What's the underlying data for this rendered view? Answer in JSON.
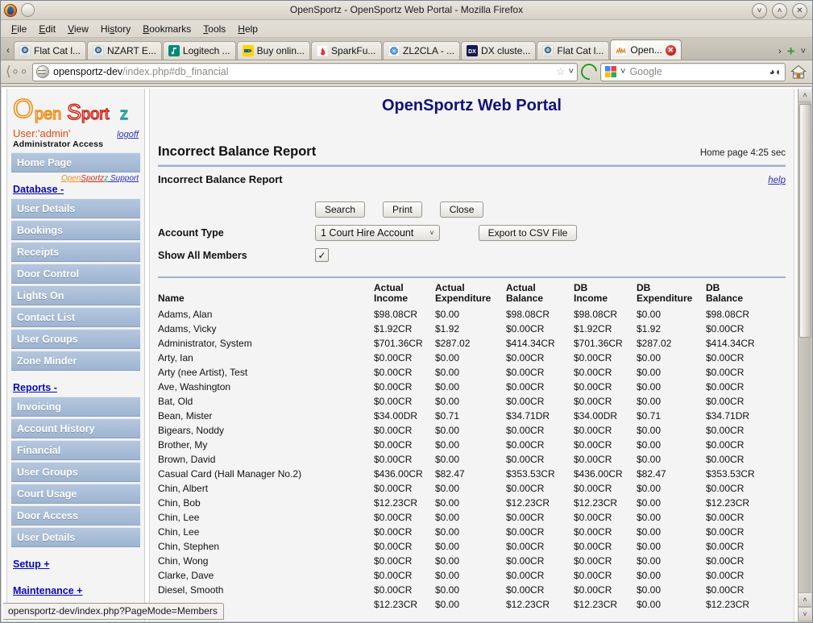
{
  "window": {
    "title": "OpenSportz - OpenSportz Web Portal - Mozilla Firefox",
    "minimize_label": "˅",
    "maximize_label": "˄",
    "close_label": "✕"
  },
  "menubar": [
    {
      "label": "File",
      "accel": "F"
    },
    {
      "label": "Edit",
      "accel": "E"
    },
    {
      "label": "View",
      "accel": "V"
    },
    {
      "label": "History",
      "accel": "s"
    },
    {
      "label": "Bookmarks",
      "accel": "B"
    },
    {
      "label": "Tools",
      "accel": "T"
    },
    {
      "label": "Help",
      "accel": "H"
    }
  ],
  "tabbar": {
    "scroll_left_icon": "‹",
    "scroll_right_icon": "›",
    "new_tab_icon": "+",
    "list_all_icon": "˅",
    "tabs": [
      {
        "label": "Flat Cat l...",
        "icon": "globe-photo-icon",
        "active": false
      },
      {
        "label": "NZART E...",
        "icon": "globe-photo-icon",
        "active": false
      },
      {
        "label": "Logitech ...",
        "icon": "music-note-icon",
        "active": false
      },
      {
        "label": "Buy onlin...",
        "icon": "trademe-icon",
        "active": false
      },
      {
        "label": "SparkFu...",
        "icon": "sparkfun-flame-icon",
        "active": false
      },
      {
        "label": "ZL2CLA - ...",
        "icon": "blue-grid-icon",
        "active": false
      },
      {
        "label": "DX cluste...",
        "icon": "dx-badge-icon",
        "active": false
      },
      {
        "label": "Flat Cat l...",
        "icon": "globe-photo-icon",
        "active": false
      },
      {
        "label": "Open...",
        "icon": "opensportz-icon",
        "active": true,
        "closable": true,
        "close_icon": "✕"
      }
    ]
  },
  "navbar": {
    "back_forward_icon": "back-forward-icon",
    "url_prefix": "opensportz-dev",
    "url_suffix": "/index.php#db_financial",
    "url_full": "opensportz-dev/index.php#db_financial",
    "bookmark_star_icon": "☆",
    "dropdown_icon": "˅",
    "reload_icon": "reload-icon",
    "search_engine": "google-icon",
    "search_placeholder": "Google",
    "search_submit_icon": "binoculars-icon",
    "home_icon": "home-icon"
  },
  "sidebar": {
    "logo": {
      "part_o": "O",
      "part_pen": "pen",
      "part_s": "S",
      "part_portz_port": "port",
      "part_z": "z",
      "color_orange": "#ef8f1c",
      "color_red": "#cf2a1d",
      "color_teal": "#1f9c9c"
    },
    "user_label": "User:'admin'",
    "logoff_label": "logoff",
    "access_label": "Administrator Access",
    "home_button": "Home Page",
    "support_link": {
      "open": "Open",
      "sportz": "Sportz",
      "z": "z",
      "support": " Support"
    },
    "database_header": "Database -",
    "database_items": [
      {
        "label": "User Details"
      },
      {
        "label": "Bookings"
      },
      {
        "label": "Receipts"
      },
      {
        "label": "Door Control"
      },
      {
        "label": "Lights On"
      },
      {
        "label": "Contact List"
      },
      {
        "label": "User Groups"
      },
      {
        "label": "Zone Minder"
      }
    ],
    "reports_header": "Reports -",
    "reports_items": [
      {
        "label": "Invoicing"
      },
      {
        "label": "Account History"
      },
      {
        "label": "Financial"
      },
      {
        "label": "User Groups"
      },
      {
        "label": "Court Usage"
      },
      {
        "label": "Door Access"
      },
      {
        "label": "User Details"
      }
    ],
    "setup_header": "Setup +",
    "maintenance_header": "Maintenance +"
  },
  "main": {
    "portal_title": "OpenSportz Web Portal",
    "report_title": "Incorrect Balance Report",
    "home_page_timer": "Home page 4:25 sec",
    "sub_title": "Incorrect Balance Report",
    "help_link": "help",
    "buttons": {
      "search": "Search",
      "print": "Print",
      "close": "Close",
      "export_csv": "Export to CSV File"
    },
    "account_type_label": "Account Type",
    "account_type_value": "1   Court Hire Account",
    "account_type_caret": "˅",
    "show_all_label": "Show All Members",
    "show_all_checked_icon": "✓"
  },
  "table": {
    "headers": [
      {
        "line1": "Name",
        "line2": ""
      },
      {
        "line1": "Actual",
        "line2": "Income"
      },
      {
        "line1": "Actual",
        "line2": "Expenditure"
      },
      {
        "line1": "Actual",
        "line2": "Balance"
      },
      {
        "line1": "DB",
        "line2": "Income"
      },
      {
        "line1": "DB",
        "line2": "Expenditure"
      },
      {
        "line1": "DB",
        "line2": "Balance"
      }
    ],
    "rows": [
      [
        "Adams, Alan",
        "$98.08CR",
        "$0.00",
        "$98.08CR",
        "$98.08CR",
        "$0.00",
        "$98.08CR"
      ],
      [
        "Adams, Vicky",
        "$1.92CR",
        "$1.92",
        "$0.00CR",
        "$1.92CR",
        "$1.92",
        "$0.00CR"
      ],
      [
        "Administrator, System",
        "$701.36CR",
        "$287.02",
        "$414.34CR",
        "$701.36CR",
        "$287.02",
        "$414.34CR"
      ],
      [
        "Arty, Ian",
        "$0.00CR",
        "$0.00",
        "$0.00CR",
        "$0.00CR",
        "$0.00",
        "$0.00CR"
      ],
      [
        "Arty (nee Artist), Test",
        "$0.00CR",
        "$0.00",
        "$0.00CR",
        "$0.00CR",
        "$0.00",
        "$0.00CR"
      ],
      [
        "Ave, Washington",
        "$0.00CR",
        "$0.00",
        "$0.00CR",
        "$0.00CR",
        "$0.00",
        "$0.00CR"
      ],
      [
        "Bat, Old",
        "$0.00CR",
        "$0.00",
        "$0.00CR",
        "$0.00CR",
        "$0.00",
        "$0.00CR"
      ],
      [
        "Bean, Mister",
        "$34.00DR",
        "$0.71",
        "$34.71DR",
        "$34.00DR",
        "$0.71",
        "$34.71DR"
      ],
      [
        "Bigears, Noddy",
        "$0.00CR",
        "$0.00",
        "$0.00CR",
        "$0.00CR",
        "$0.00",
        "$0.00CR"
      ],
      [
        "Brother, My",
        "$0.00CR",
        "$0.00",
        "$0.00CR",
        "$0.00CR",
        "$0.00",
        "$0.00CR"
      ],
      [
        "Brown, David",
        "$0.00CR",
        "$0.00",
        "$0.00CR",
        "$0.00CR",
        "$0.00",
        "$0.00CR"
      ],
      [
        "Casual Card (Hall Manager No.2)",
        "$436.00CR",
        "$82.47",
        "$353.53CR",
        "$436.00CR",
        "$82.47",
        "$353.53CR"
      ],
      [
        "Chin, Albert",
        "$0.00CR",
        "$0.00",
        "$0.00CR",
        "$0.00CR",
        "$0.00",
        "$0.00CR"
      ],
      [
        "Chin, Bob",
        "$12.23CR",
        "$0.00",
        "$12.23CR",
        "$12.23CR",
        "$0.00",
        "$12.23CR"
      ],
      [
        "Chin, Lee",
        "$0.00CR",
        "$0.00",
        "$0.00CR",
        "$0.00CR",
        "$0.00",
        "$0.00CR"
      ],
      [
        "Chin, Lee",
        "$0.00CR",
        "$0.00",
        "$0.00CR",
        "$0.00CR",
        "$0.00",
        "$0.00CR"
      ],
      [
        "Chin, Stephen",
        "$0.00CR",
        "$0.00",
        "$0.00CR",
        "$0.00CR",
        "$0.00",
        "$0.00CR"
      ],
      [
        "Chin, Wong",
        "$0.00CR",
        "$0.00",
        "$0.00CR",
        "$0.00CR",
        "$0.00",
        "$0.00CR"
      ],
      [
        "Clarke, Dave",
        "$0.00CR",
        "$0.00",
        "$0.00CR",
        "$0.00CR",
        "$0.00",
        "$0.00CR"
      ],
      [
        "Diesel, Smooth",
        "$0.00CR",
        "$0.00",
        "$0.00CR",
        "$0.00CR",
        "$0.00",
        "$0.00CR"
      ],
      [
        "",
        "$12.23CR",
        "$0.00",
        "$12.23CR",
        "$12.23CR",
        "$0.00",
        "$12.23CR"
      ]
    ]
  },
  "statusbar": {
    "text": "opensportz-dev/index.php?PageMode=Members"
  },
  "scrollbar": {
    "up_icon": "˄",
    "down_icon": "˅"
  }
}
